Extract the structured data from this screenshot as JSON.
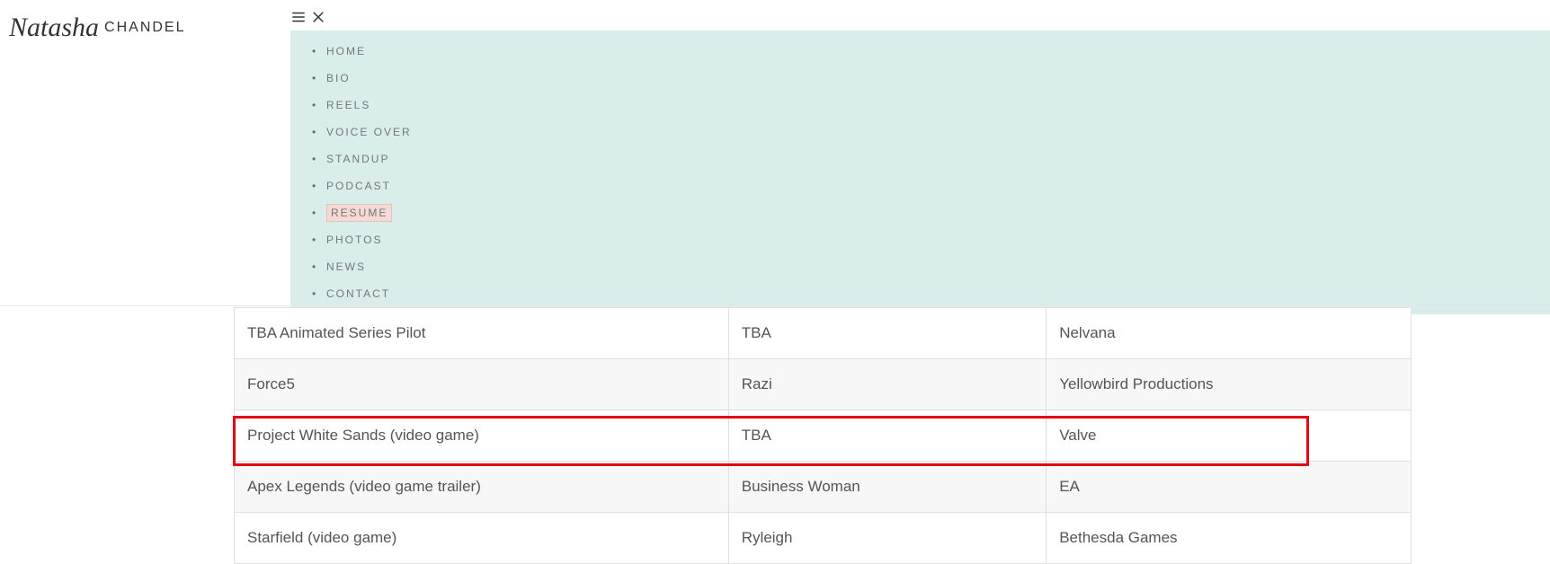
{
  "logo": {
    "script": "Natasha",
    "caps": "CHANDEL"
  },
  "nav": {
    "items": [
      {
        "label": "HOME",
        "active": false
      },
      {
        "label": "BIO",
        "active": false
      },
      {
        "label": "REELS",
        "active": false
      },
      {
        "label": "VOICE OVER",
        "active": false
      },
      {
        "label": "STANDUP",
        "active": false
      },
      {
        "label": "PODCAST",
        "active": false
      },
      {
        "label": "RESUME",
        "active": true
      },
      {
        "label": "PHOTOS",
        "active": false
      },
      {
        "label": "NEWS",
        "active": false
      },
      {
        "label": "CONTACT",
        "active": false
      }
    ]
  },
  "table": {
    "rows": [
      {
        "project": "TBA Animated Series Pilot",
        "role": "TBA",
        "company": "Nelvana",
        "highlighted": false
      },
      {
        "project": "Force5",
        "role": "Razi",
        "company": "Yellowbird Productions",
        "highlighted": false
      },
      {
        "project": "Project White Sands (video game)",
        "role": "TBA",
        "company": "Valve",
        "highlighted": true
      },
      {
        "project": "Apex Legends (video game trailer)",
        "role": "Business Woman",
        "company": "EA",
        "highlighted": false
      },
      {
        "project": "Starfield (video game)",
        "role": "Ryleigh",
        "company": "Bethesda Games",
        "highlighted": false
      }
    ]
  }
}
